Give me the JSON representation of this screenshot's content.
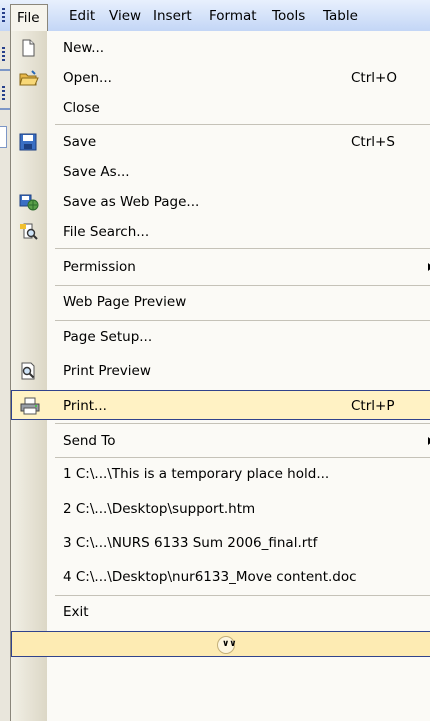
{
  "menubar": {
    "items": [
      {
        "label": "File"
      },
      {
        "label": "Edit"
      },
      {
        "label": "View"
      },
      {
        "label": "Insert"
      },
      {
        "label": "Format"
      },
      {
        "label": "Tools"
      },
      {
        "label": "Table"
      }
    ]
  },
  "file_menu": {
    "items": [
      {
        "label": "New...",
        "icon": "new-document-icon"
      },
      {
        "label": "Open...",
        "shortcut": "Ctrl+O",
        "icon": "open-folder-icon"
      },
      {
        "label": "Close"
      },
      {
        "label": "Save",
        "shortcut": "Ctrl+S",
        "icon": "save-disk-icon"
      },
      {
        "label": "Save As..."
      },
      {
        "label": "Save as Web Page...",
        "icon": "save-web-page-icon"
      },
      {
        "label": "File Search...",
        "icon": "file-search-icon"
      },
      {
        "label": "Permission",
        "submenu": true
      },
      {
        "label": "Web Page Preview"
      },
      {
        "label": "Page Setup..."
      },
      {
        "label": "Print Preview",
        "icon": "print-preview-icon"
      },
      {
        "label": "Print...",
        "shortcut": "Ctrl+P",
        "icon": "printer-icon",
        "highlighted": true
      },
      {
        "label": "Send To",
        "submenu": true
      },
      {
        "label": "1 C:\\...\\This is a temporary place hold..."
      },
      {
        "label": "2 C:\\...\\Desktop\\support.htm"
      },
      {
        "label": "3 C:\\...\\NURS 6133 Sum 2006_final.rtf"
      },
      {
        "label": "4 C:\\...\\Desktop\\nur6133_Move content.doc"
      },
      {
        "label": "Exit"
      }
    ],
    "expand_label": "»",
    "colors": {
      "highlight_fill": "#fff2c4",
      "highlight_border": "#31438c",
      "menubar_top": "#e8f0fd",
      "menubar_bottom": "#c3d6f6"
    }
  }
}
